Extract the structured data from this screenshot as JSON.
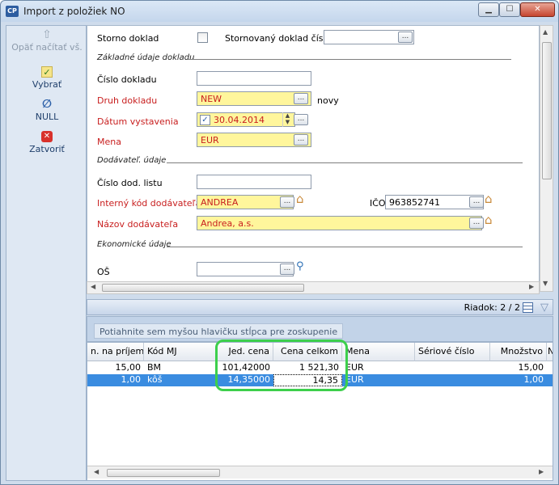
{
  "window": {
    "title": "Import z položiek NO",
    "app_icon": "CP"
  },
  "sidebar": {
    "items": [
      {
        "label": "Opäť načítať vš.",
        "icon": "reload-icon",
        "enabled": false
      },
      {
        "label": "Vybrať",
        "icon": "check-icon",
        "enabled": true
      },
      {
        "label": "NULL",
        "icon": "null-icon",
        "enabled": true
      },
      {
        "label": "Zatvoriť",
        "icon": "close-icon",
        "enabled": true
      }
    ]
  },
  "form": {
    "storno_label": "Storno doklad",
    "storno_ref_label": "Stornovaný doklad číslo",
    "storno_ref_value": "",
    "section_basic": "Základné údaje dokladu",
    "cislo_label": "Číslo dokladu",
    "cislo_value": "",
    "druh_label": "Druh dokladu",
    "druh_value": "NEW",
    "druh_desc": "novy",
    "datum_label": "Dátum vystavenia",
    "datum_value": "30.04.2014",
    "mena_label": "Mena",
    "mena_value": "EUR",
    "section_supplier": "Dodávateľ. údaje",
    "dod_list_label": "Číslo dod. listu",
    "dod_list_value": "",
    "interny_label": "Interný kód dodávateľa",
    "interny_value": "ANDREA",
    "ico_label": "IČO",
    "ico_value": "963852741",
    "nazov_label": "Názov dodávateľa",
    "nazov_value": "Andrea, a.s.",
    "section_econ": "Ekonomické údaje",
    "os_label": "OŠ",
    "os_value": ""
  },
  "status": {
    "row_info": "Riadok: 2 / 2"
  },
  "grid": {
    "group_hint": "Potiahnite sem myšou hlavičku stĺpca pre zoskupenie",
    "columns": [
      "n. na príjemku",
      "Kód MJ",
      "Jed. cena",
      "Cena celkom",
      "Mena",
      "Sériové číslo",
      "Množstvo",
      "N"
    ],
    "rows": [
      {
        "qty_in": "15,00",
        "kod_mj": "BM",
        "jed_cena": "101,42000",
        "cena_celkom": "1 521,30",
        "mena": "EUR",
        "seriove": "",
        "mnozstvo": "15,00"
      },
      {
        "qty_in": "1,00",
        "kod_mj": "kôš",
        "jed_cena": "14,35000",
        "cena_celkom": "14,35",
        "mena": "EUR",
        "seriove": "",
        "mnozstvo": "1,00"
      }
    ],
    "selected_row": 2
  },
  "colors": {
    "required_label": "#c81e1e",
    "required_field_bg": "#fff69c",
    "selection": "#3a8ce0",
    "highlight_annotation": "#3dcf4c"
  }
}
